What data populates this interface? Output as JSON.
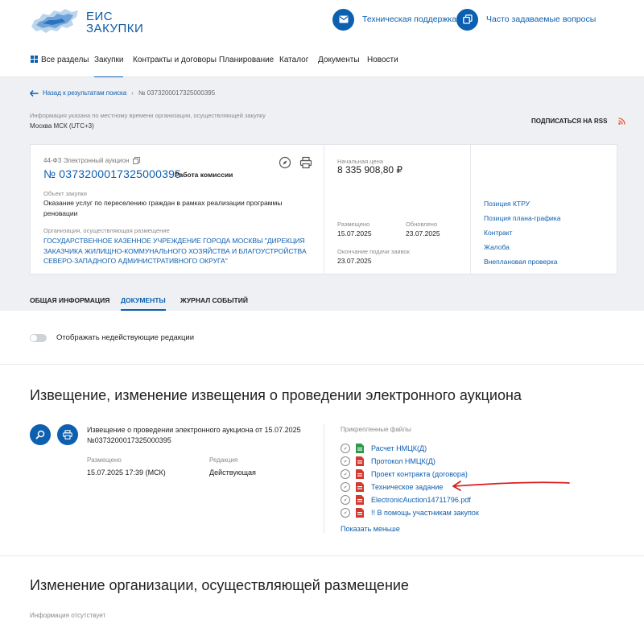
{
  "header": {
    "logo_line1": "ЕИС",
    "logo_line2": "ЗАКУПКИ",
    "support_label": "Техническая поддержка",
    "faq_label": "Часто задаваемые вопросы"
  },
  "nav": {
    "items": [
      {
        "label": "Все разделы",
        "icon": "grid-icon"
      },
      {
        "label": "Закупки",
        "active": true
      },
      {
        "label": "Контракты и договоры"
      },
      {
        "label": "Планирование"
      },
      {
        "label": "Каталог"
      },
      {
        "label": "Документы"
      },
      {
        "label": "Новости"
      }
    ]
  },
  "breadcrumb": {
    "back_label": "Назад к результатам поиска",
    "current": "№ 0373200017325000395"
  },
  "timezone": {
    "info": "Информация указана по местному времени организации, осуществляющей закупку",
    "value": "Москва МСК (UTC+3)"
  },
  "rss": {
    "label": "ПОДПИСАТЬСЯ НА RSS"
  },
  "purchase": {
    "law": "44-ФЗ Электронный аукцион",
    "number": "№ 0373200017325000395",
    "status": "Работа комиссии",
    "object_label": "Объект закупки",
    "object_value": "Оказание услуг по переселению граждан в рамках реализации программы реновации",
    "org_label": "Организация, осуществляющая размещение",
    "org_value": "ГОСУДАРСТВЕННОЕ КАЗЕННОЕ УЧРЕЖДЕНИЕ ГОРОДА МОСКВЫ \"ДИРЕКЦИЯ ЗАКАЗЧИКА ЖИЛИЩНО-КОММУНАЛЬНОГО ХОЗЯЙСТВА И БЛАГОУСТРОЙСТВА СЕВЕРО-ЗАПАДНОГО АДМИНИСТРАТИВНОГО ОКРУГА\"",
    "price_label": "Начальная цена",
    "price_value": "8 335 908,80 ₽",
    "posted_label": "Размещено",
    "posted_value": "15.07.2025",
    "updated_label": "Обновлено",
    "updated_value": "23.07.2025",
    "deadline_label": "Окончание подачи заявок",
    "deadline_value": "23.07.2025",
    "side_links": [
      "Позиция КТРУ",
      "Позиция плана-графика",
      "Контракт",
      "Жалоба",
      "Внеплановая проверка"
    ]
  },
  "tabs": [
    {
      "label": "ОБЩАЯ ИНФОРМАЦИЯ"
    },
    {
      "label": "ДОКУМЕНТЫ",
      "active": true
    },
    {
      "label": "ЖУРНАЛ СОБЫТИЙ"
    }
  ],
  "toggle": {
    "label": "Отображать недействующие редакции",
    "on": false
  },
  "notice_section": {
    "title": "Извещение, изменение извещения о проведении электронного аукциона",
    "doc_title": "Извещение о проведении электронного аукциона от 15.07.2025 №0373200017325000395",
    "posted_label": "Размещено",
    "posted_value": "15.07.2025 17:39 (МСК)",
    "edition_label": "Редакция",
    "edition_value": "Действующая",
    "files_label": "Прикрепленные файлы",
    "files": [
      {
        "name": "Расчет НМЦК(Д)",
        "type": "xls"
      },
      {
        "name": "Протокол НМЦК(Д)",
        "type": "pdf"
      },
      {
        "name": "Проект контракта (договора)",
        "type": "pdf"
      },
      {
        "name": "Техническое задание",
        "type": "pdf"
      },
      {
        "name": "ElectronicAuction14711796.pdf",
        "type": "pdf"
      },
      {
        "name": "!! В помощь участникам закупок",
        "type": "pdf"
      }
    ],
    "show_less": "Показать меньше"
  },
  "org_change_section": {
    "title": "Изменение организации, осуществляющей размещение",
    "empty": "Информация отсутствует"
  },
  "colors": {
    "brand": "#0d5fb0",
    "pdf": "#d23a2f",
    "xls": "#2e9a47",
    "annotation": "#d81e1e"
  }
}
